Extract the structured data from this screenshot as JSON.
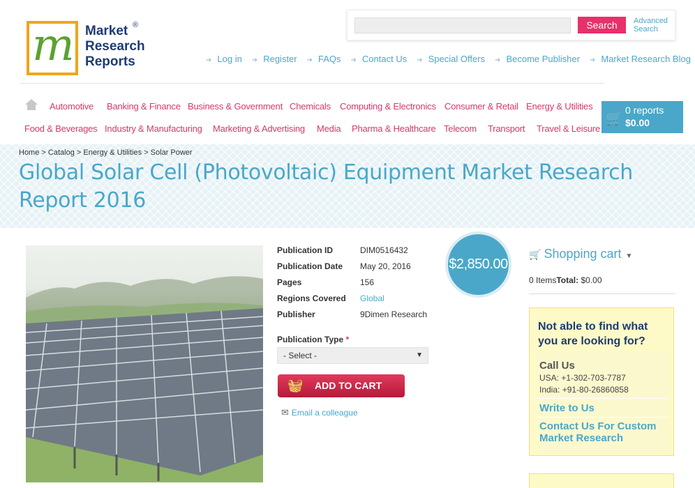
{
  "header": {
    "logo_lines": [
      "Market",
      "Research",
      "Reports"
    ],
    "logo_mark": "m",
    "logo_reg": "®",
    "search": {
      "placeholder": "",
      "button_label": "Search",
      "advanced_label_1": "Advanced",
      "advanced_label_2": "Search"
    },
    "top_links": [
      "Log in",
      "Register",
      "FAQs",
      "Contact Us",
      "Special Offers",
      "Become Publisher",
      "Market Research Blog"
    ]
  },
  "nav": {
    "row1": [
      "Automotive",
      "Banking & Finance",
      "Business & Government",
      "Chemicals",
      "Computing & Electronics",
      "Consumer & Retail",
      "Energy & Utilities"
    ],
    "row2": [
      "Food & Beverages",
      "Industry & Manufacturing",
      "Marketing & Advertising",
      "Media",
      "Pharma & Healthcare",
      "Telecom",
      "Transport",
      "Travel & Leisure"
    ]
  },
  "cart": {
    "count": "0 reports",
    "total": "$0.00"
  },
  "breadcrumb": [
    "Home",
    "Catalog",
    "Energy & Utilities",
    "Solar Power"
  ],
  "page_title": "Global Solar Cell (Photovoltaic) Equipment Market Research Report 2016",
  "product": {
    "price": "$2,850.00",
    "details": [
      {
        "label": "Publication ID",
        "value": "DIM0516432"
      },
      {
        "label": "Publication Date",
        "value": "May 20, 2016"
      },
      {
        "label": "Pages",
        "value": "156"
      },
      {
        "label": "Regions Covered",
        "value": "Global"
      },
      {
        "label": "Publisher",
        "value": "9Dimen Research"
      }
    ],
    "pub_type_label": "Publication Type",
    "pub_type_required": "*",
    "pub_type_selected": "- Select -",
    "add_to_cart": "ADD TO CART",
    "email_colleague": "Email a colleague"
  },
  "sidebar": {
    "shopping_cart": "Shopping cart",
    "items_label": "0 Items",
    "total_label": "Total:",
    "total_value": "$0.00",
    "help_title": "Not able to find what you are looking for?",
    "call_us": "Call Us",
    "phone_usa": "USA: +1-302-703-7787",
    "phone_india": "India: +91-80-26860858",
    "write_to_us": "Write to Us",
    "contact_custom": "Contact Us For Custom Market Research"
  },
  "colors": {
    "accent": "#4aa7c9",
    "brand_pink": "#e8306a",
    "nav_red": "#d7386a",
    "cart_red": "#c8243f"
  }
}
